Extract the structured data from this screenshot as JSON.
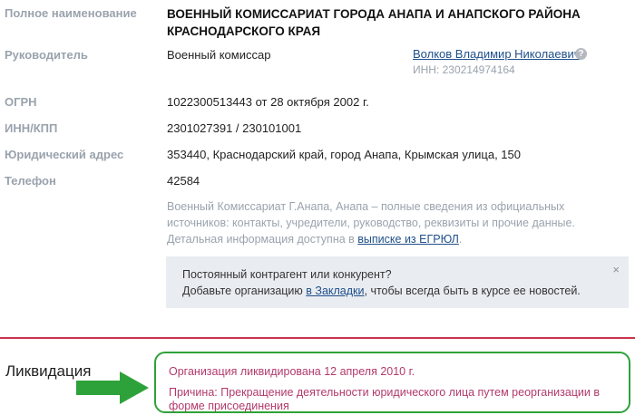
{
  "full_name": {
    "label": "Полное наименование",
    "value": "ВОЕННЫЙ КОМИССАРИАТ ГОРОДА АНАПА И АНАПСКОГО РАЙОНА КРАСНОДАРСКОГО КРАЯ"
  },
  "director": {
    "label": "Руководитель",
    "position": "Военный комиссар",
    "name": "Волков Владимир Николаевич",
    "help": "?",
    "inn": "ИНН: 230214974164"
  },
  "ogrn": {
    "label": "ОГРН",
    "value": "1022300513443 от 28 октября 2002 г."
  },
  "inn_kpp": {
    "label": "ИНН/КПП",
    "value": "2301027391 / 230101001"
  },
  "address": {
    "label": "Юридический адрес",
    "value": "353440, Краснодарский край, город Анапа, Крымская улица, 150"
  },
  "phone": {
    "label": "Телефон",
    "value": "42584"
  },
  "description": {
    "text": "Военный Комиссариат Г.Анапа, Анапа – полные сведения из официальных источников: контакты, учредители, руководство, реквизиты и прочие данные. Детальная информация доступна в ",
    "link": "выписке из ЕГРЮЛ",
    "suffix": "."
  },
  "notice": {
    "line1": "Постоянный контрагент или конкурент?",
    "line2_before": "Добавьте организацию ",
    "line2_link": "в Закладки",
    "line2_after": ", чтобы всегда быть в курсе ее новостей.",
    "close": "×"
  },
  "liquidation": {
    "title": "Ликвидация",
    "status": "Организация ликвидирована 12 апреля 2010 г.",
    "reason": "Причина: Прекращение деятельности юридического лица путем реорганизации в форме присоединения"
  },
  "colors": {
    "label": "#9aa3ad",
    "link": "#1f4f8a",
    "liquidation_text": "#b23a6a",
    "highlight_green": "#2ea23a",
    "divider_red": "#c9344b"
  }
}
